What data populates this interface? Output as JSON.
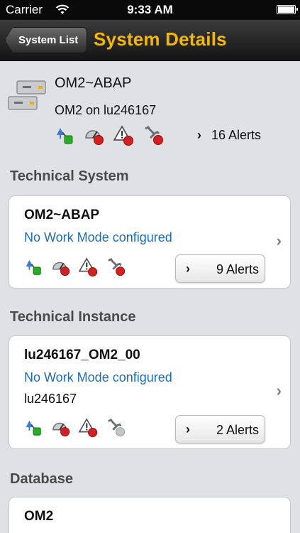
{
  "status_bar": {
    "carrier": "Carrier",
    "time": "9:33 AM"
  },
  "nav": {
    "back_label": "System List",
    "title": "System Details"
  },
  "system": {
    "name": "OM2~ABAP",
    "host": "OM2 on lu246167",
    "alerts": "16 Alerts",
    "status_icons": [
      "availability-ok-icon",
      "performance-alert-icon",
      "exceptions-alert-icon",
      "configuration-alert-icon"
    ]
  },
  "sections": [
    {
      "title": "Technical System",
      "name": "OM2~ABAP",
      "mode": "No Work Mode configured",
      "alerts": "9 Alerts"
    },
    {
      "title": "Technical Instance",
      "name": "lu246167_OM2_00",
      "mode": "No Work Mode configured",
      "host": "lu246167",
      "alerts": "2 Alerts"
    },
    {
      "title": "Database",
      "name": "OM2"
    }
  ],
  "colors": {
    "nav_title": "#f4b800",
    "link_blue": "#1c6dbf",
    "alert_red": "#d42020",
    "ok_green": "#22b022"
  }
}
